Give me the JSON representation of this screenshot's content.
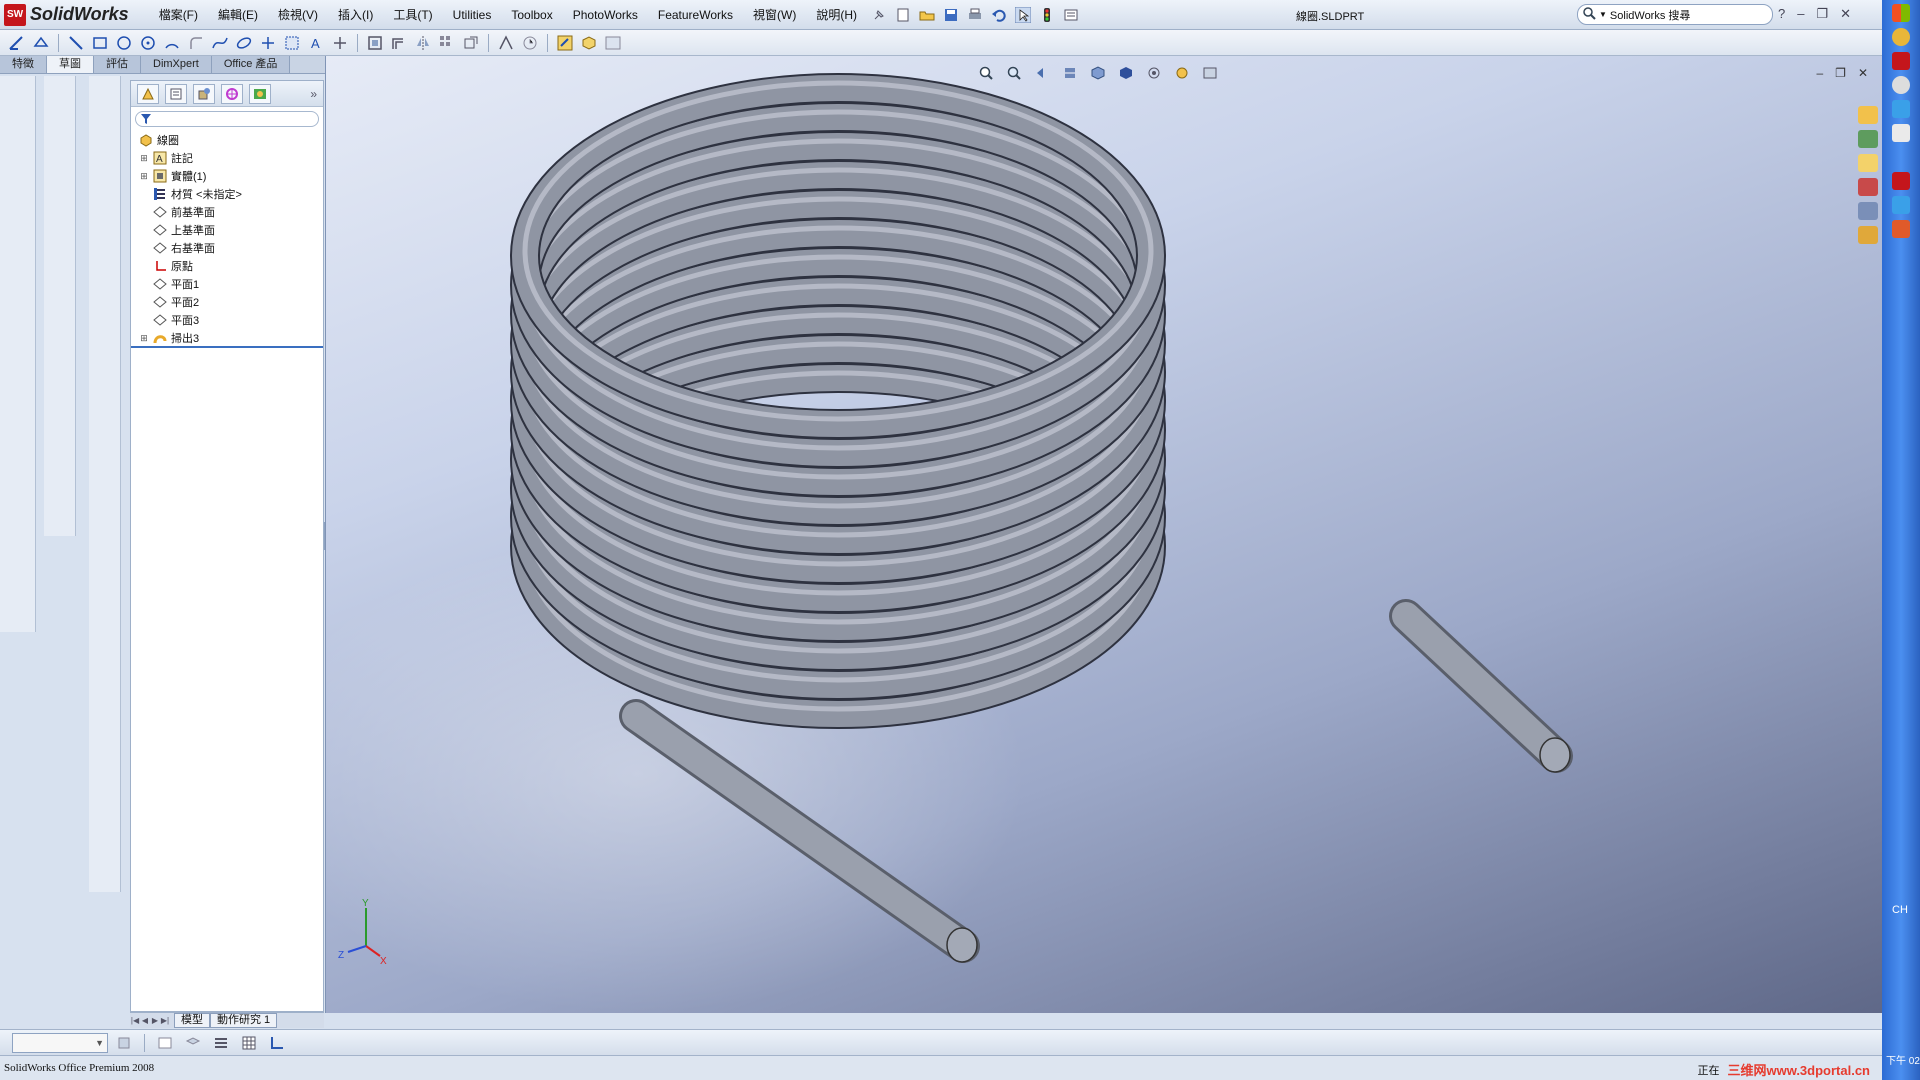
{
  "app": {
    "logo_text": "SolidWorks",
    "document_title": "線圈.SLDPRT"
  },
  "menu": [
    "檔案(F)",
    "編輯(E)",
    "檢視(V)",
    "插入(I)",
    "工具(T)",
    "Utilities",
    "Toolbox",
    "PhotoWorks",
    "FeatureWorks",
    "視窗(W)",
    "說明(H)"
  ],
  "search": {
    "placeholder": "SolidWorks 搜尋"
  },
  "command_tabs": [
    "特徵",
    "草圖",
    "評估",
    "DimXpert",
    "Office 產品"
  ],
  "command_tabs_active": "草圖",
  "feature_tree": {
    "root": "線圈",
    "items": [
      {
        "label": "註記",
        "icon": "annotation-icon",
        "expandable": true
      },
      {
        "label": "實體(1)",
        "icon": "solid-body-icon",
        "expandable": true
      },
      {
        "label": "材質 <未指定>",
        "icon": "material-icon",
        "expandable": false
      },
      {
        "label": "前基準面",
        "icon": "plane-icon",
        "expandable": false
      },
      {
        "label": "上基準面",
        "icon": "plane-icon",
        "expandable": false
      },
      {
        "label": "右基準面",
        "icon": "plane-icon",
        "expandable": false
      },
      {
        "label": "原點",
        "icon": "origin-icon",
        "expandable": false
      },
      {
        "label": "平面1",
        "icon": "plane-icon",
        "expandable": false
      },
      {
        "label": "平面2",
        "icon": "plane-icon",
        "expandable": false
      },
      {
        "label": "平面3",
        "icon": "plane-icon",
        "expandable": false
      },
      {
        "label": "掃出3",
        "icon": "sweep-icon",
        "expandable": true
      }
    ]
  },
  "bottom_tabs": [
    "模型",
    "動作研究 1"
  ],
  "status": {
    "left": "SolidWorks Office Premium 2008",
    "right": "正在",
    "watermark": "三维网www.3dportal.cn"
  },
  "system_tray": {
    "lang": "CH",
    "time": "下午 02"
  },
  "colors": {
    "accent": "#3a6fc0",
    "brand": "#c4161c",
    "coil_metal": "#8f95a3"
  }
}
